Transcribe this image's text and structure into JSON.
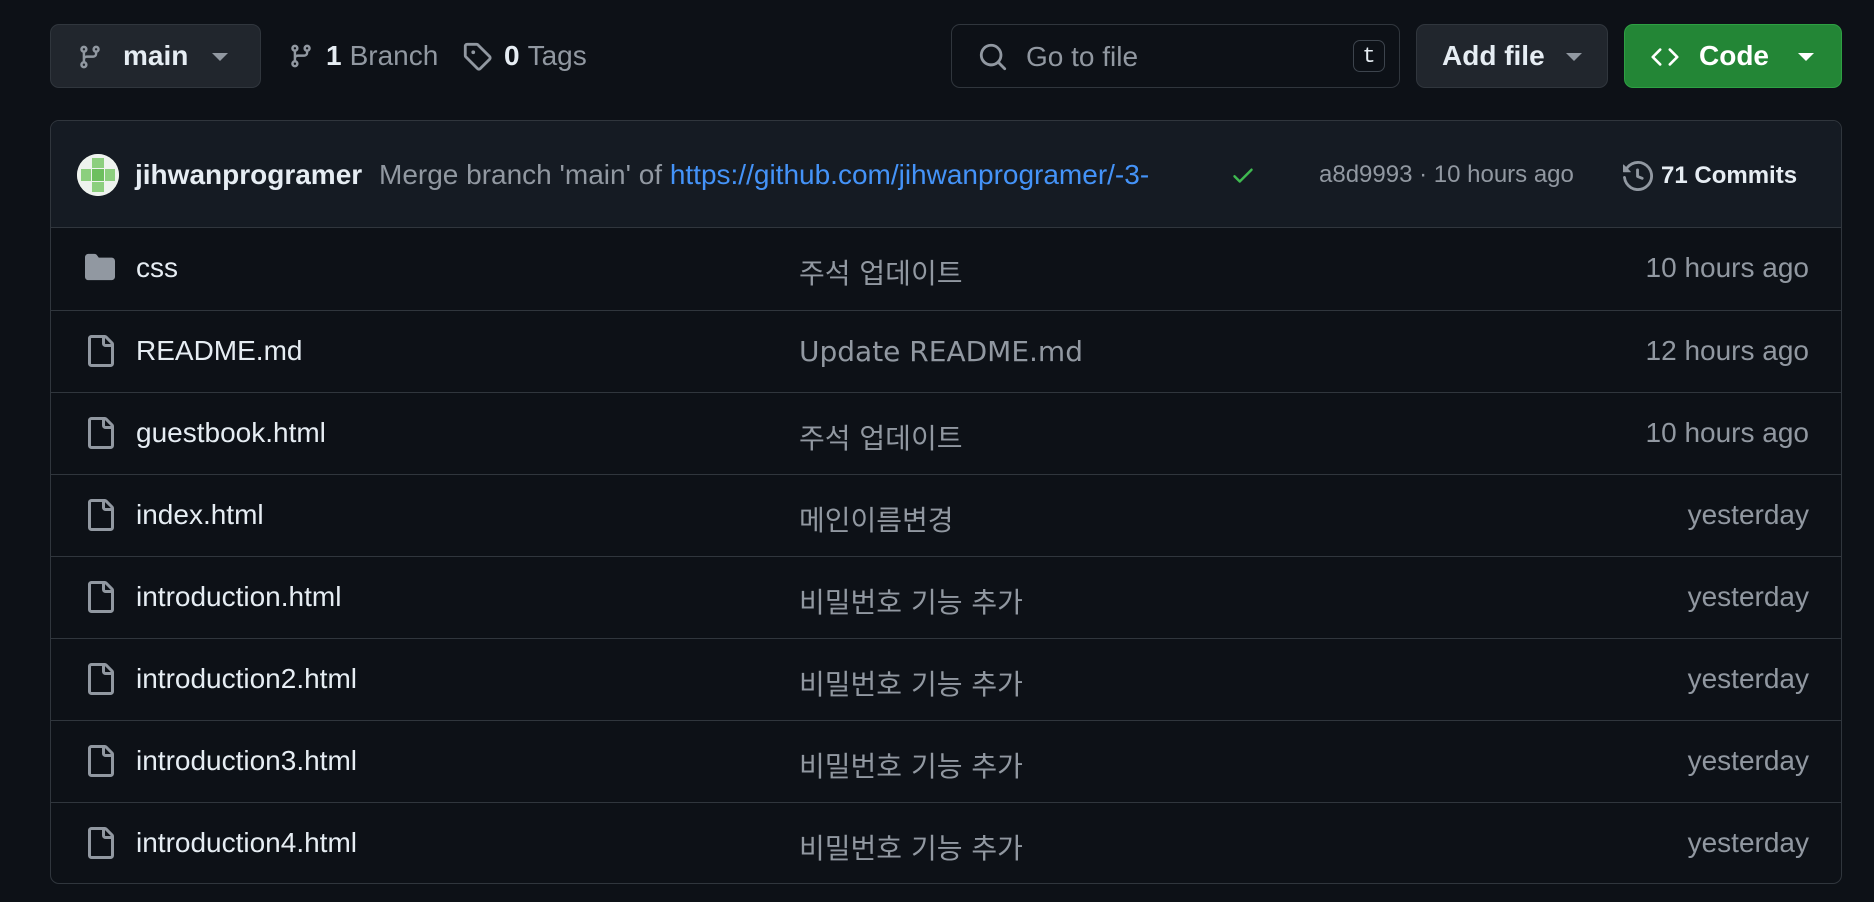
{
  "toolbar": {
    "branch_name": "main",
    "branch_count": "1",
    "branch_label": "Branch",
    "tag_count": "0",
    "tag_label": "Tags",
    "search_placeholder": "Go to file",
    "search_shortcut": "t",
    "add_file_label": "Add file",
    "code_label": "Code"
  },
  "commit": {
    "author": "jihwanprogramer",
    "message_prefix": "Merge branch 'main' of ",
    "message_link": "https://github.com/jihwanprogramer/-3-",
    "status": "success",
    "sha_time": "a8d9993 · 10 hours ago",
    "commits_label": "71 Commits"
  },
  "files": [
    {
      "name": "css",
      "type": "folder",
      "message": "주석 업데이트",
      "time": "10 hours ago"
    },
    {
      "name": "README.md",
      "type": "file",
      "message": "Update README.md",
      "time": "12 hours ago"
    },
    {
      "name": "guestbook.html",
      "type": "file",
      "message": "주석 업데이트",
      "time": "10 hours ago"
    },
    {
      "name": "index.html",
      "type": "file",
      "message": "메인이름변경",
      "time": "yesterday"
    },
    {
      "name": "introduction.html",
      "type": "file",
      "message": "비밀번호 기능 추가",
      "time": "yesterday"
    },
    {
      "name": "introduction2.html",
      "type": "file",
      "message": "비밀번호 기능 추가",
      "time": "yesterday"
    },
    {
      "name": "introduction3.html",
      "type": "file",
      "message": "비밀번호 기능 추가",
      "time": "yesterday"
    },
    {
      "name": "introduction4.html",
      "type": "file",
      "message": "비밀번호 기능 추가",
      "time": "yesterday"
    }
  ],
  "colors": {
    "background": "#0d1117",
    "border": "#30363d",
    "code_button": "#238636",
    "link": "#4493f8",
    "success": "#3fb950"
  }
}
